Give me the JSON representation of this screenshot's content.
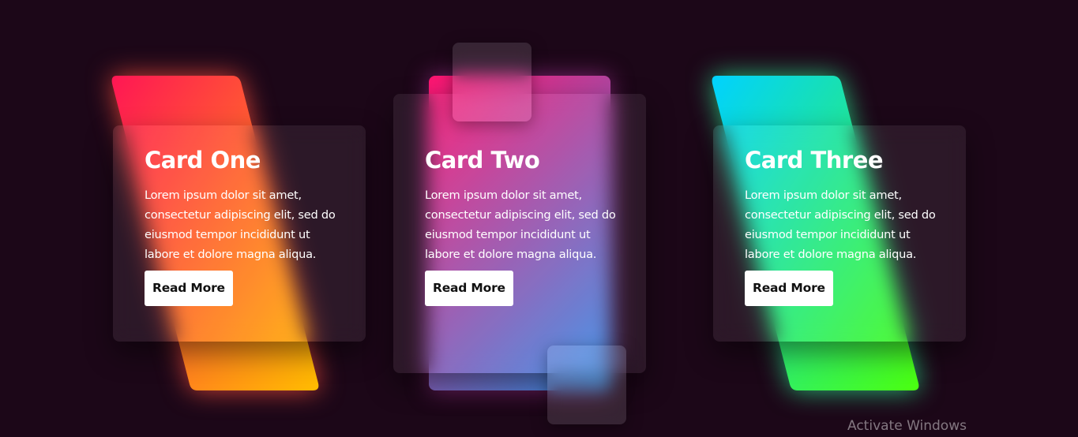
{
  "cards": [
    {
      "title": "Card One",
      "description": "Lorem ipsum dolor sit amet, consectetur adipiscing elit, sed do eiusmod tempor incididunt ut labore et dolore magna aliqua.",
      "button": "Read More",
      "gradient": [
        "#ff1654",
        "#ffbc00"
      ]
    },
    {
      "title": "Card Two",
      "description": "Lorem ipsum dolor sit amet, consectetur adipiscing elit, sed do eiusmod tempor incididunt ut labore et dolore magna aliqua.",
      "button": "Read More",
      "gradient": [
        "#ff1470",
        "#3392ea"
      ]
    },
    {
      "title": "Card Three",
      "description": "Lorem ipsum dolor sit amet, consectetur adipiscing elit, sed do eiusmod tempor incididunt ut labore et dolore magna aliqua.",
      "button": "Read More",
      "gradient": [
        "#00d2ff",
        "#4bff0f"
      ]
    }
  ],
  "watermark": "Activate Windows",
  "background": "#1c0718"
}
